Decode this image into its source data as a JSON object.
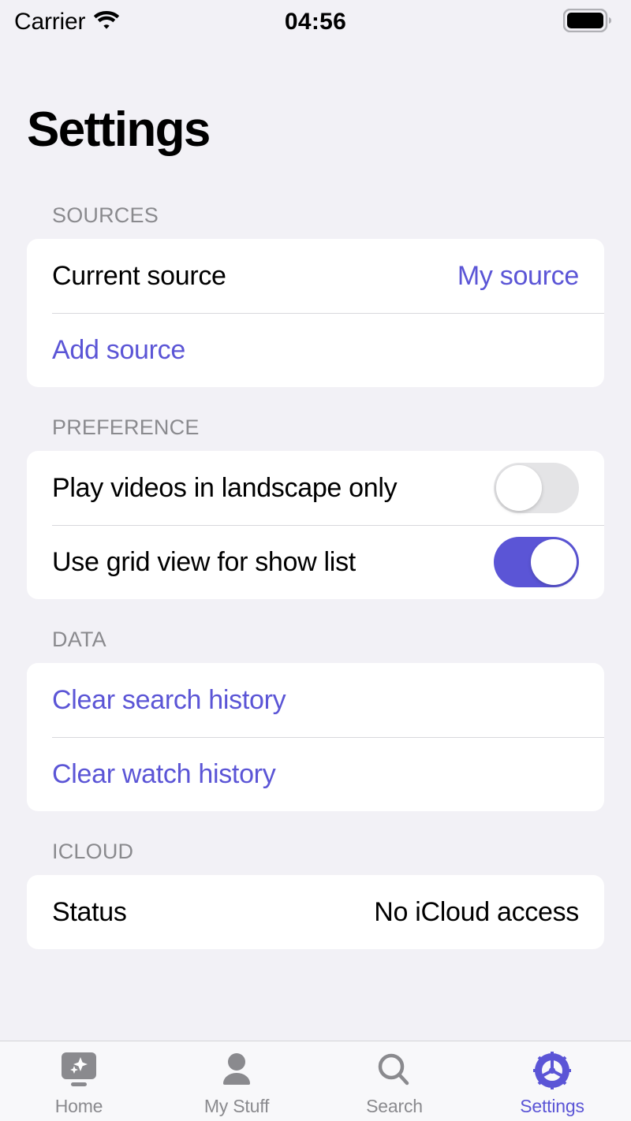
{
  "status_bar": {
    "carrier": "Carrier",
    "wifi_icon": "wifi-icon",
    "time": "04:56",
    "battery_icon": "battery-full-icon"
  },
  "header": {
    "title": "Settings"
  },
  "colors": {
    "accent": "#5b55d6",
    "background": "#f2f1f6",
    "card": "#ffffff",
    "section_header": "#8a8a8e",
    "separator": "#d8d8dc",
    "toggle_off_track": "#e4e4e6"
  },
  "sections": [
    {
      "header": "SOURCES",
      "rows": [
        {
          "label": "Current source",
          "value": "My source"
        },
        {
          "label": "Add source"
        }
      ]
    },
    {
      "header": "PREFERENCE",
      "rows": [
        {
          "label": "Play videos in landscape only",
          "toggle": "off"
        },
        {
          "label": "Use grid view for show list",
          "toggle": "on"
        }
      ]
    },
    {
      "header": "DATA",
      "rows": [
        {
          "label": "Clear search history"
        },
        {
          "label": "Clear watch history"
        }
      ]
    },
    {
      "header": "ICLOUD",
      "rows": [
        {
          "label": "Status",
          "value": "No iCloud access"
        }
      ]
    }
  ],
  "tabbar": {
    "items": [
      {
        "label": "Home",
        "icon": "tv-sparkle-icon",
        "active": false
      },
      {
        "label": "My Stuff",
        "icon": "person-icon",
        "active": false
      },
      {
        "label": "Search",
        "icon": "search-icon",
        "active": false
      },
      {
        "label": "Settings",
        "icon": "gear-icon",
        "active": true
      }
    ]
  }
}
